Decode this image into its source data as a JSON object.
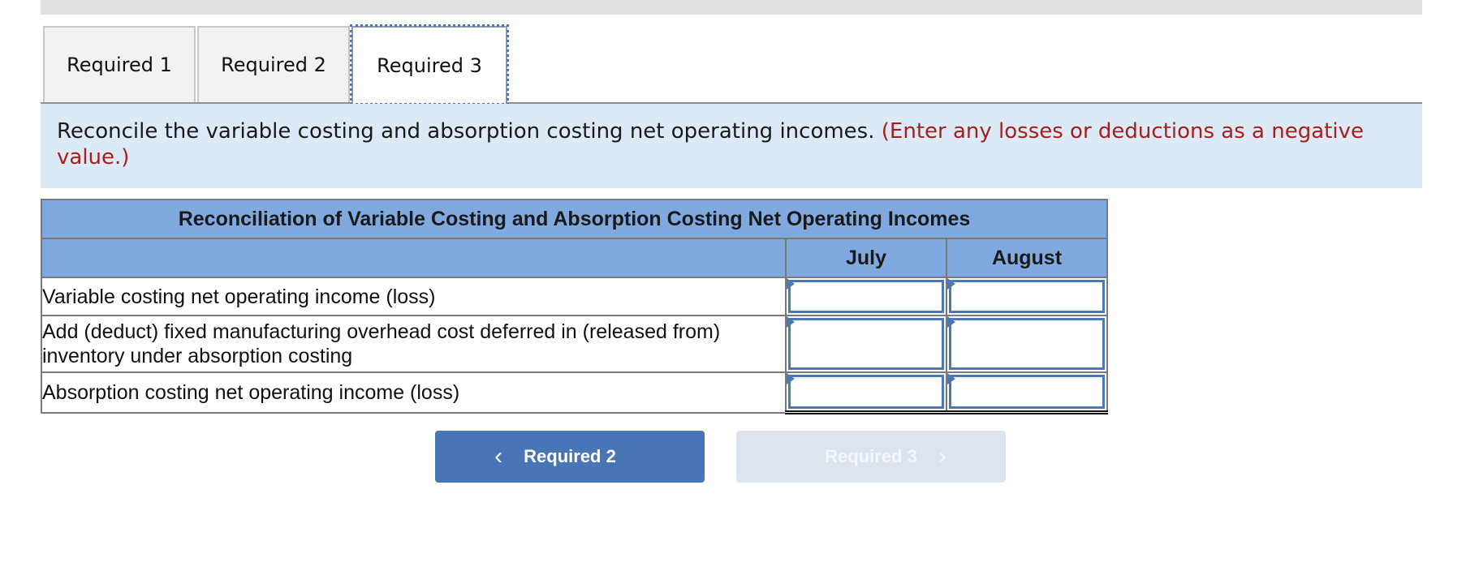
{
  "tabs": [
    {
      "label": "Required 1",
      "active": false
    },
    {
      "label": "Required 2",
      "active": false
    },
    {
      "label": "Required 3",
      "active": true
    }
  ],
  "instructions": {
    "text": "Reconcile the variable costing and absorption costing net operating incomes.",
    "note": "(Enter any losses or deductions as a negative value.)"
  },
  "table": {
    "title": "Reconciliation of Variable Costing and Absorption Costing Net Operating Incomes",
    "columns": [
      "",
      "July",
      "August"
    ],
    "rows": [
      {
        "label": "Variable costing net operating income (loss)",
        "july": "",
        "august": ""
      },
      {
        "label": "Add (deduct) fixed manufacturing overhead cost deferred in (released from) inventory under absorption costing",
        "july": "",
        "august": ""
      },
      {
        "label": "Absorption costing net operating income (loss)",
        "july": "",
        "august": ""
      }
    ]
  },
  "nav": {
    "prev_label": "Required 2",
    "prev_icon": "chevron-left-icon",
    "next_label": "Required 3",
    "next_icon": "chevron-right-icon",
    "next_disabled": true
  },
  "colors": {
    "accent": "#4775b5",
    "header_blue": "#80aadf",
    "instruction_bg": "#dceaf7",
    "note_red": "#a3211f",
    "disabled_button": "#dbe4ef"
  }
}
